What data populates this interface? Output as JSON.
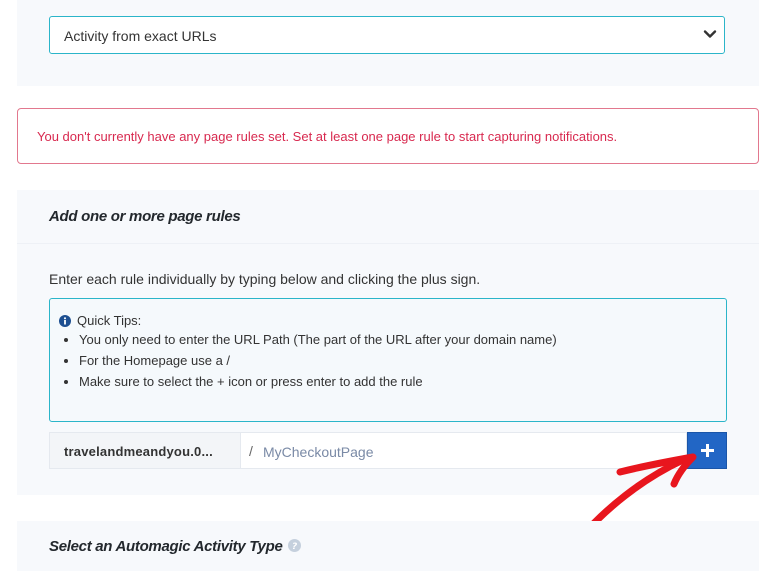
{
  "activity_source": {
    "selected": "Activity from exact URLs"
  },
  "alert": {
    "message": "You don't currently have any page rules set. Set at least one page rule to start capturing notifications."
  },
  "page_rules": {
    "title": "Add one or more page rules",
    "instructions": "Enter each rule individually by typing below and clicking the plus sign.",
    "tips": {
      "header": "Quick Tips:",
      "items": [
        "You only need to enter the URL Path (The part of the URL after your domain name)",
        "For the Homepage use a /",
        "Make sure to select the + icon or press enter to add the rule"
      ]
    },
    "domain": "travelandmeandyou.0...",
    "slash": "/",
    "path_placeholder": "MyCheckoutPage",
    "add_label": "+"
  },
  "activity_type": {
    "title": "Select an Automagic Activity Type"
  },
  "colors": {
    "accent_teal": "#2bb5c9",
    "alert_red": "#d8294f",
    "button_blue": "#2266c5",
    "annotation_red": "#e8161e"
  }
}
